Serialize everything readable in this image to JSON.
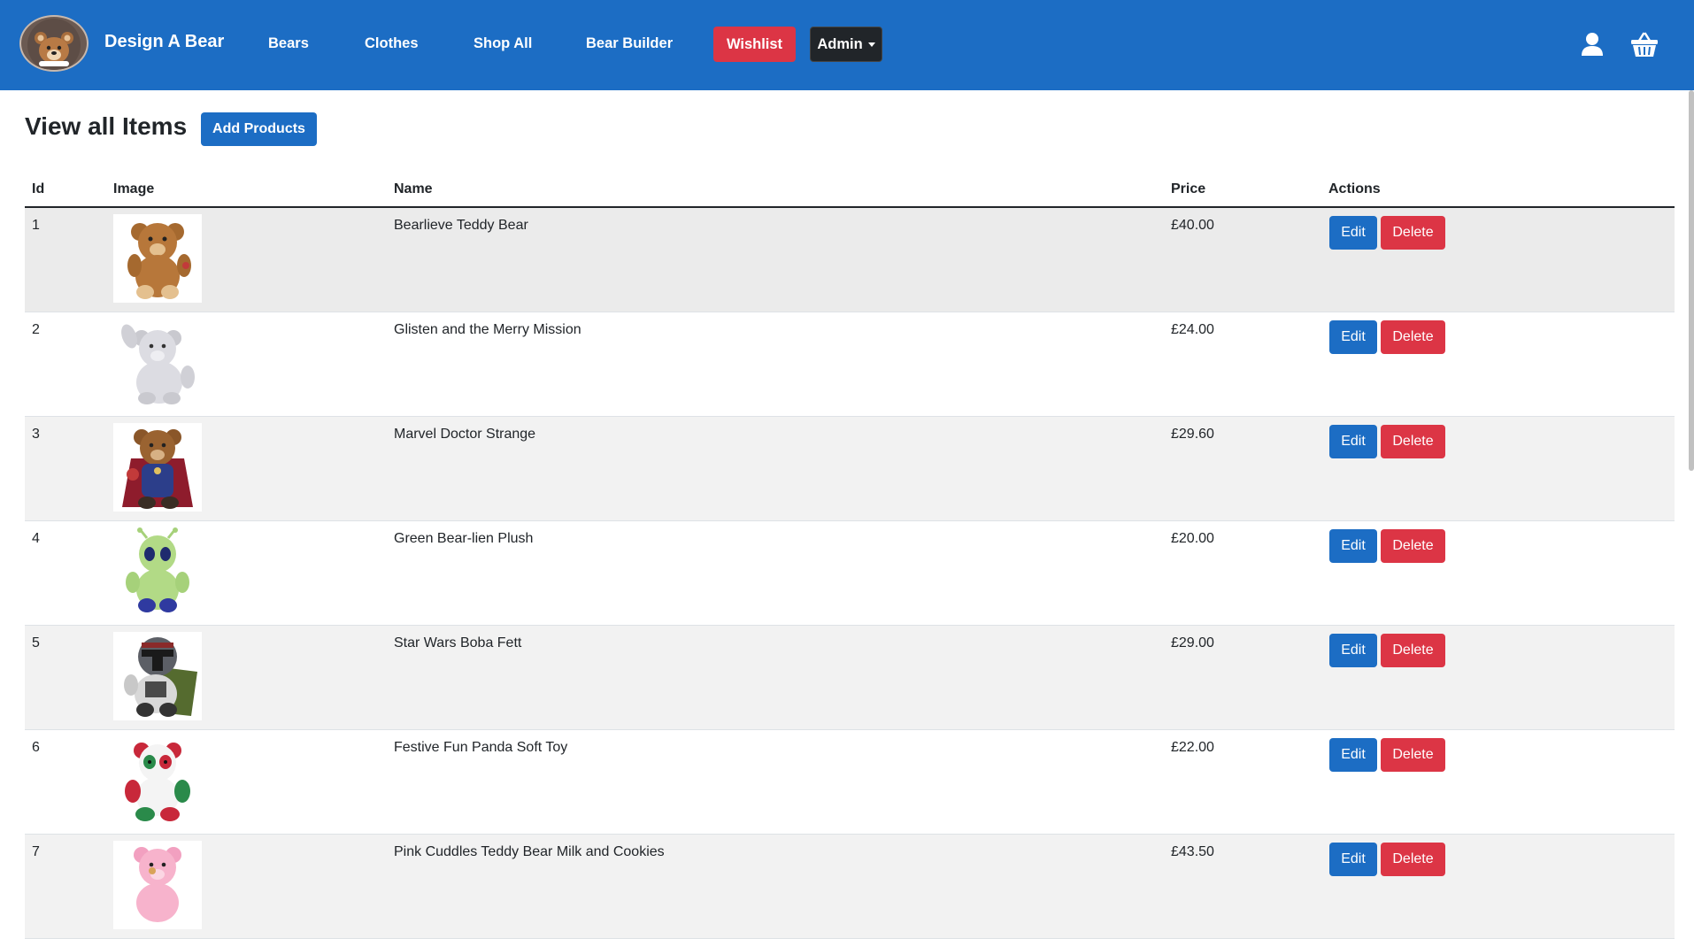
{
  "brand": {
    "name": "Design A Bear",
    "logo_text": "Design A Bear"
  },
  "nav": {
    "links": [
      "Bears",
      "Clothes",
      "Shop All",
      "Bear Builder"
    ],
    "wishlist": "Wishlist",
    "admin": "Admin",
    "icons": [
      "user-icon",
      "basket-icon"
    ]
  },
  "page": {
    "title": "View all Items",
    "add_button": "Add Products"
  },
  "table": {
    "headers": {
      "id": "Id",
      "image": "Image",
      "name": "Name",
      "price": "Price",
      "actions": "Actions"
    },
    "edit_label": "Edit",
    "delete_label": "Delete",
    "rows": [
      {
        "id": "1",
        "name": "Bearlieve Teddy Bear",
        "price": "£40.00",
        "image": "brown-teddy-bear"
      },
      {
        "id": "2",
        "name": "Glisten and the Merry Mission",
        "price": "£24.00",
        "image": "white-sparkle-bear"
      },
      {
        "id": "3",
        "name": "Marvel Doctor Strange",
        "price": "£29.60",
        "image": "doctor-strange-bear"
      },
      {
        "id": "4",
        "name": "Green Bear-lien Plush",
        "price": "£20.00",
        "image": "green-alien-bear"
      },
      {
        "id": "5",
        "name": "Star Wars Boba Fett",
        "price": "£29.00",
        "image": "boba-fett-bear"
      },
      {
        "id": "6",
        "name": "Festive Fun Panda Soft Toy",
        "price": "£22.00",
        "image": "festive-panda"
      },
      {
        "id": "7",
        "name": "Pink Cuddles Teddy Bear Milk and Cookies",
        "price": "£43.50",
        "image": "pink-teddy-bear"
      }
    ]
  },
  "colors": {
    "primary": "#1c6dc4",
    "danger": "#dc3545",
    "dark": "#212529"
  }
}
